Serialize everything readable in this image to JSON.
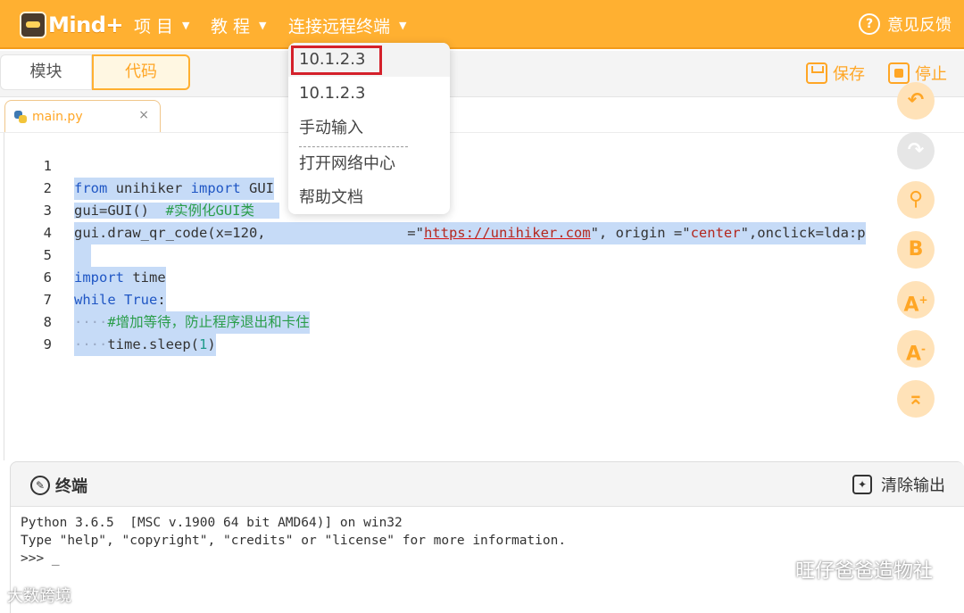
{
  "app": {
    "logo_text": "Mind+"
  },
  "menu": [
    {
      "label": "项 目",
      "caret": "▼"
    },
    {
      "label": "教 程",
      "caret": "▼"
    },
    {
      "label": "连接远程终端",
      "caret": "▼"
    }
  ],
  "feedback": {
    "icon_glyph": "?",
    "label": "意见反馈"
  },
  "mode_tabs": {
    "blocks": "模块",
    "code": "代码"
  },
  "toolbar": {
    "save": "保存",
    "stop": "停止"
  },
  "file_tab": {
    "name": "main.py",
    "close": "×"
  },
  "editor": {
    "line_numbers": [
      "1",
      "2",
      "3",
      "4",
      "5",
      "6",
      "7",
      "8",
      "9"
    ],
    "l1": {
      "kw1": "from",
      "t1": " unihiker ",
      "kw2": "import",
      "t2": " GUI"
    },
    "l2": {
      "t1": "gui=GUI()",
      "dots": "  ",
      "cm": "#实例化GUI类"
    },
    "l3": {
      "t1": "gui.draw_qr_code(x=120,",
      "t2": "=\"",
      "url": "https://unihiker.com",
      "t3": "\", origin =\"",
      "st": "center",
      "t4": "\",onclick=l",
      "t5": "da:p"
    },
    "l5": {
      "kw": "import",
      "t": " time"
    },
    "l6": {
      "kw1": "while",
      "t": " ",
      "kw2": "True",
      "t2": ":"
    },
    "l7": {
      "dots": "····",
      "cm": "#增加等待，防止程序退出和卡住"
    },
    "l8": {
      "dots": "····",
      "t": "time.sleep(",
      "nm": "1",
      "t2": ")"
    }
  },
  "dropdown": {
    "items": [
      "10.1.2.3",
      "10.1.2.3",
      "手动输入",
      "打开网络中心",
      "帮助文档"
    ]
  },
  "side_buttons": {
    "b": "B",
    "font_up": "A",
    "font_up_sup": "+",
    "font_down": "A",
    "font_down_sup": "-",
    "top": "⌅"
  },
  "terminal": {
    "title": "终端",
    "icon_glyph": "✎",
    "clear_label": "清除输出",
    "clear_icon_glyph": "✦",
    "lines": [
      "Python 3.6.5  [MSC v.1900 64 bit AMD64)] on win32",
      "Type \"help\", \"copyright\", \"credits\" or \"license\" for more information.",
      ">>> _"
    ]
  },
  "watermarks": {
    "right": "旺仔爸爸造物社",
    "left": "大数跨境"
  },
  "colors": {
    "accent": "#ffb031",
    "accent_text": "#ffa625",
    "highlight_outline": "#d4202a",
    "selection": "#c6dbf7"
  }
}
